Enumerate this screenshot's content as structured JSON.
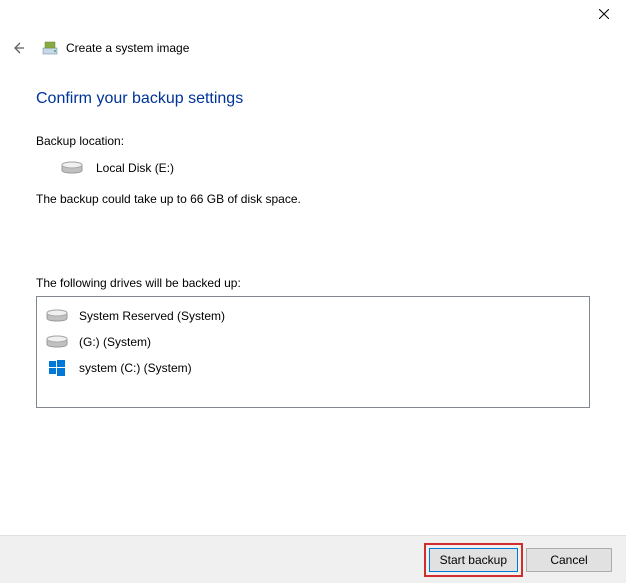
{
  "window": {
    "title": "Create a system image"
  },
  "heading": "Confirm your backup settings",
  "backup_location_label": "Backup location:",
  "backup_location_name": "Local Disk (E:)",
  "size_info": "The backup could take up to 66 GB of disk space.",
  "drives_label": "The following drives will be backed up:",
  "drives": [
    {
      "name": "System Reserved (System)",
      "icon": "hdd"
    },
    {
      "name": "(G:) (System)",
      "icon": "hdd"
    },
    {
      "name": "system (C:) (System)",
      "icon": "windows"
    }
  ],
  "buttons": {
    "start": "Start backup",
    "cancel": "Cancel"
  }
}
